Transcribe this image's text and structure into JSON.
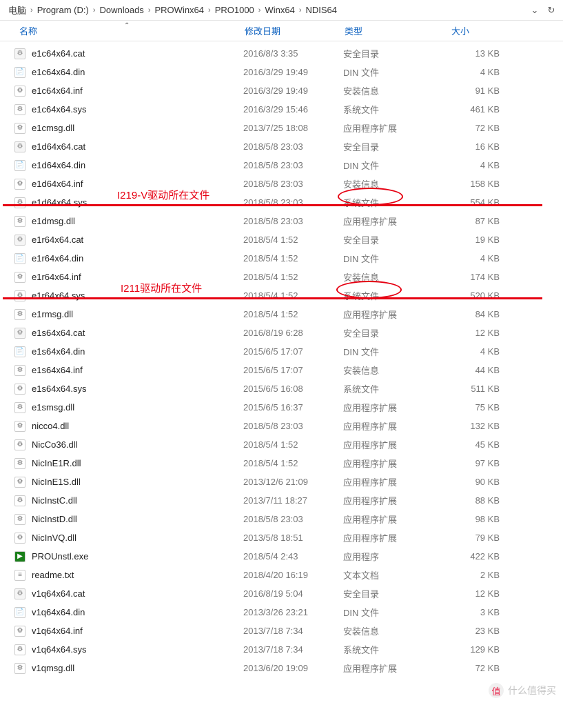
{
  "breadcrumb": {
    "segments": [
      "电脑",
      "Program (D:)",
      "Downloads",
      "PROWinx64",
      "PRO1000",
      "Winx64",
      "NDIS64"
    ],
    "separator": "›"
  },
  "nav": {
    "dropdown": "⌄",
    "refresh": "↻"
  },
  "columns": {
    "name": "名称",
    "date": "修改日期",
    "type": "类型",
    "size": "大小"
  },
  "icon_types": {
    "cat": {
      "glyph": "⚙",
      "bg": "#f5f5f5",
      "fg": "#888"
    },
    "din": {
      "glyph": "📄",
      "bg": "#fff",
      "fg": "#888"
    },
    "inf": {
      "glyph": "⚙",
      "bg": "#fff",
      "fg": "#777"
    },
    "sys": {
      "glyph": "⚙",
      "bg": "#fff",
      "fg": "#777"
    },
    "dll": {
      "glyph": "⚙",
      "bg": "#fff",
      "fg": "#777"
    },
    "exe": {
      "glyph": "▶",
      "bg": "#1a7f1a",
      "fg": "#fff"
    },
    "txt": {
      "glyph": "≡",
      "bg": "#fff",
      "fg": "#888"
    }
  },
  "files": [
    {
      "name": "e1c64x64.cat",
      "date": "2016/8/3 3:35",
      "type": "安全目录",
      "size": "13 KB",
      "icon": "cat"
    },
    {
      "name": "e1c64x64.din",
      "date": "2016/3/29 19:49",
      "type": "DIN 文件",
      "size": "4 KB",
      "icon": "din"
    },
    {
      "name": "e1c64x64.inf",
      "date": "2016/3/29 19:49",
      "type": "安装信息",
      "size": "91 KB",
      "icon": "inf"
    },
    {
      "name": "e1c64x64.sys",
      "date": "2016/3/29 15:46",
      "type": "系统文件",
      "size": "461 KB",
      "icon": "sys"
    },
    {
      "name": "e1cmsg.dll",
      "date": "2013/7/25 18:08",
      "type": "应用程序扩展",
      "size": "72 KB",
      "icon": "dll"
    },
    {
      "name": "e1d64x64.cat",
      "date": "2018/5/8 23:03",
      "type": "安全目录",
      "size": "16 KB",
      "icon": "cat"
    },
    {
      "name": "e1d64x64.din",
      "date": "2018/5/8 23:03",
      "type": "DIN 文件",
      "size": "4 KB",
      "icon": "din"
    },
    {
      "name": "e1d64x64.inf",
      "date": "2018/5/8 23:03",
      "type": "安装信息",
      "size": "158 KB",
      "icon": "inf"
    },
    {
      "name": "e1d64x64.sys",
      "date": "2018/5/8 23:03",
      "type": "系统文件",
      "size": "554 KB",
      "icon": "sys"
    },
    {
      "name": "e1dmsg.dll",
      "date": "2018/5/8 23:03",
      "type": "应用程序扩展",
      "size": "87 KB",
      "icon": "dll"
    },
    {
      "name": "e1r64x64.cat",
      "date": "2018/5/4 1:52",
      "type": "安全目录",
      "size": "19 KB",
      "icon": "cat"
    },
    {
      "name": "e1r64x64.din",
      "date": "2018/5/4 1:52",
      "type": "DIN 文件",
      "size": "4 KB",
      "icon": "din"
    },
    {
      "name": "e1r64x64.inf",
      "date": "2018/5/4 1:52",
      "type": "安装信息",
      "size": "174 KB",
      "icon": "inf"
    },
    {
      "name": "e1r64x64.sys",
      "date": "2018/5/4 1:52",
      "type": "系统文件",
      "size": "520 KB",
      "icon": "sys"
    },
    {
      "name": "e1rmsg.dll",
      "date": "2018/5/4 1:52",
      "type": "应用程序扩展",
      "size": "84 KB",
      "icon": "dll"
    },
    {
      "name": "e1s64x64.cat",
      "date": "2016/8/19 6:28",
      "type": "安全目录",
      "size": "12 KB",
      "icon": "cat"
    },
    {
      "name": "e1s64x64.din",
      "date": "2015/6/5 17:07",
      "type": "DIN 文件",
      "size": "4 KB",
      "icon": "din"
    },
    {
      "name": "e1s64x64.inf",
      "date": "2015/6/5 17:07",
      "type": "安装信息",
      "size": "44 KB",
      "icon": "inf"
    },
    {
      "name": "e1s64x64.sys",
      "date": "2015/6/5 16:08",
      "type": "系统文件",
      "size": "511 KB",
      "icon": "sys"
    },
    {
      "name": "e1smsg.dll",
      "date": "2015/6/5 16:37",
      "type": "应用程序扩展",
      "size": "75 KB",
      "icon": "dll"
    },
    {
      "name": "nicco4.dll",
      "date": "2018/5/8 23:03",
      "type": "应用程序扩展",
      "size": "132 KB",
      "icon": "dll"
    },
    {
      "name": "NicCo36.dll",
      "date": "2018/5/4 1:52",
      "type": "应用程序扩展",
      "size": "45 KB",
      "icon": "dll"
    },
    {
      "name": "NicInE1R.dll",
      "date": "2018/5/4 1:52",
      "type": "应用程序扩展",
      "size": "97 KB",
      "icon": "dll"
    },
    {
      "name": "NicInE1S.dll",
      "date": "2013/12/6 21:09",
      "type": "应用程序扩展",
      "size": "90 KB",
      "icon": "dll"
    },
    {
      "name": "NicInstC.dll",
      "date": "2013/7/11 18:27",
      "type": "应用程序扩展",
      "size": "88 KB",
      "icon": "dll"
    },
    {
      "name": "NicInstD.dll",
      "date": "2018/5/8 23:03",
      "type": "应用程序扩展",
      "size": "98 KB",
      "icon": "dll"
    },
    {
      "name": "NicInVQ.dll",
      "date": "2013/5/8 18:51",
      "type": "应用程序扩展",
      "size": "79 KB",
      "icon": "dll"
    },
    {
      "name": "PROUnstl.exe",
      "date": "2018/5/4 2:43",
      "type": "应用程序",
      "size": "422 KB",
      "icon": "exe"
    },
    {
      "name": "readme.txt",
      "date": "2018/4/20 16:19",
      "type": "文本文档",
      "size": "2 KB",
      "icon": "txt"
    },
    {
      "name": "v1q64x64.cat",
      "date": "2016/8/19 5:04",
      "type": "安全目录",
      "size": "12 KB",
      "icon": "cat"
    },
    {
      "name": "v1q64x64.din",
      "date": "2013/3/26 23:21",
      "type": "DIN 文件",
      "size": "3 KB",
      "icon": "din"
    },
    {
      "name": "v1q64x64.inf",
      "date": "2013/7/18 7:34",
      "type": "安装信息",
      "size": "23 KB",
      "icon": "inf"
    },
    {
      "name": "v1q64x64.sys",
      "date": "2013/7/18 7:34",
      "type": "系统文件",
      "size": "129 KB",
      "icon": "sys"
    },
    {
      "name": "v1qmsg.dll",
      "date": "2013/6/20 19:09",
      "type": "应用程序扩展",
      "size": "72 KB",
      "icon": "dll"
    }
  ],
  "annotations": {
    "a1": "I219-V驱动所在文件",
    "a2": "I211驱动所在文件"
  },
  "watermark": {
    "text": "什么值得买",
    "logo": "值"
  }
}
